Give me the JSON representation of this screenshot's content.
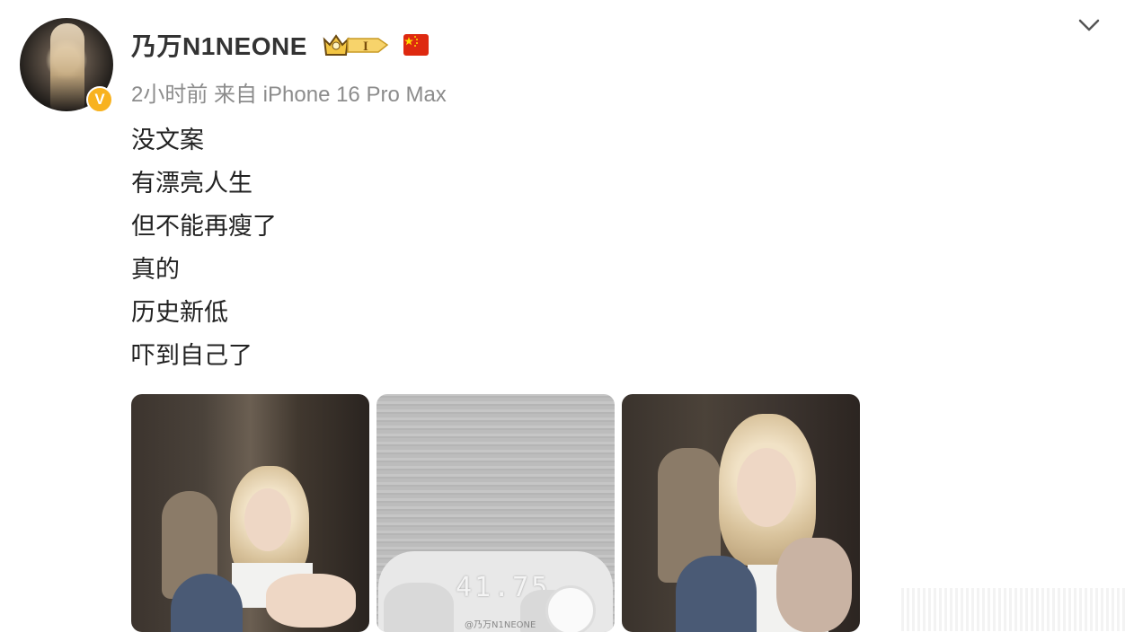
{
  "post": {
    "author": {
      "name": "乃万N1NEONE",
      "avatar_icon": "user-avatar",
      "verified_badge": "V",
      "verified_color": "#f8b21f",
      "level_badge_icon": "crown-level-badge",
      "level_text": "I",
      "flag_icon": "china-flag-icon"
    },
    "meta": "2小时前  来自 iPhone 16 Pro Max",
    "text_lines": [
      "没文案",
      "有漂亮人生",
      "但不能再瘦了",
      "真的",
      "历史新低",
      "吓到自己了"
    ],
    "menu_icon": "chevron-down-icon",
    "images": [
      {
        "name": "photo-1"
      },
      {
        "name": "photo-2-scale",
        "scale_reading": "41.75",
        "watermark": "@乃万N1NEONE"
      },
      {
        "name": "photo-3"
      }
    ]
  }
}
